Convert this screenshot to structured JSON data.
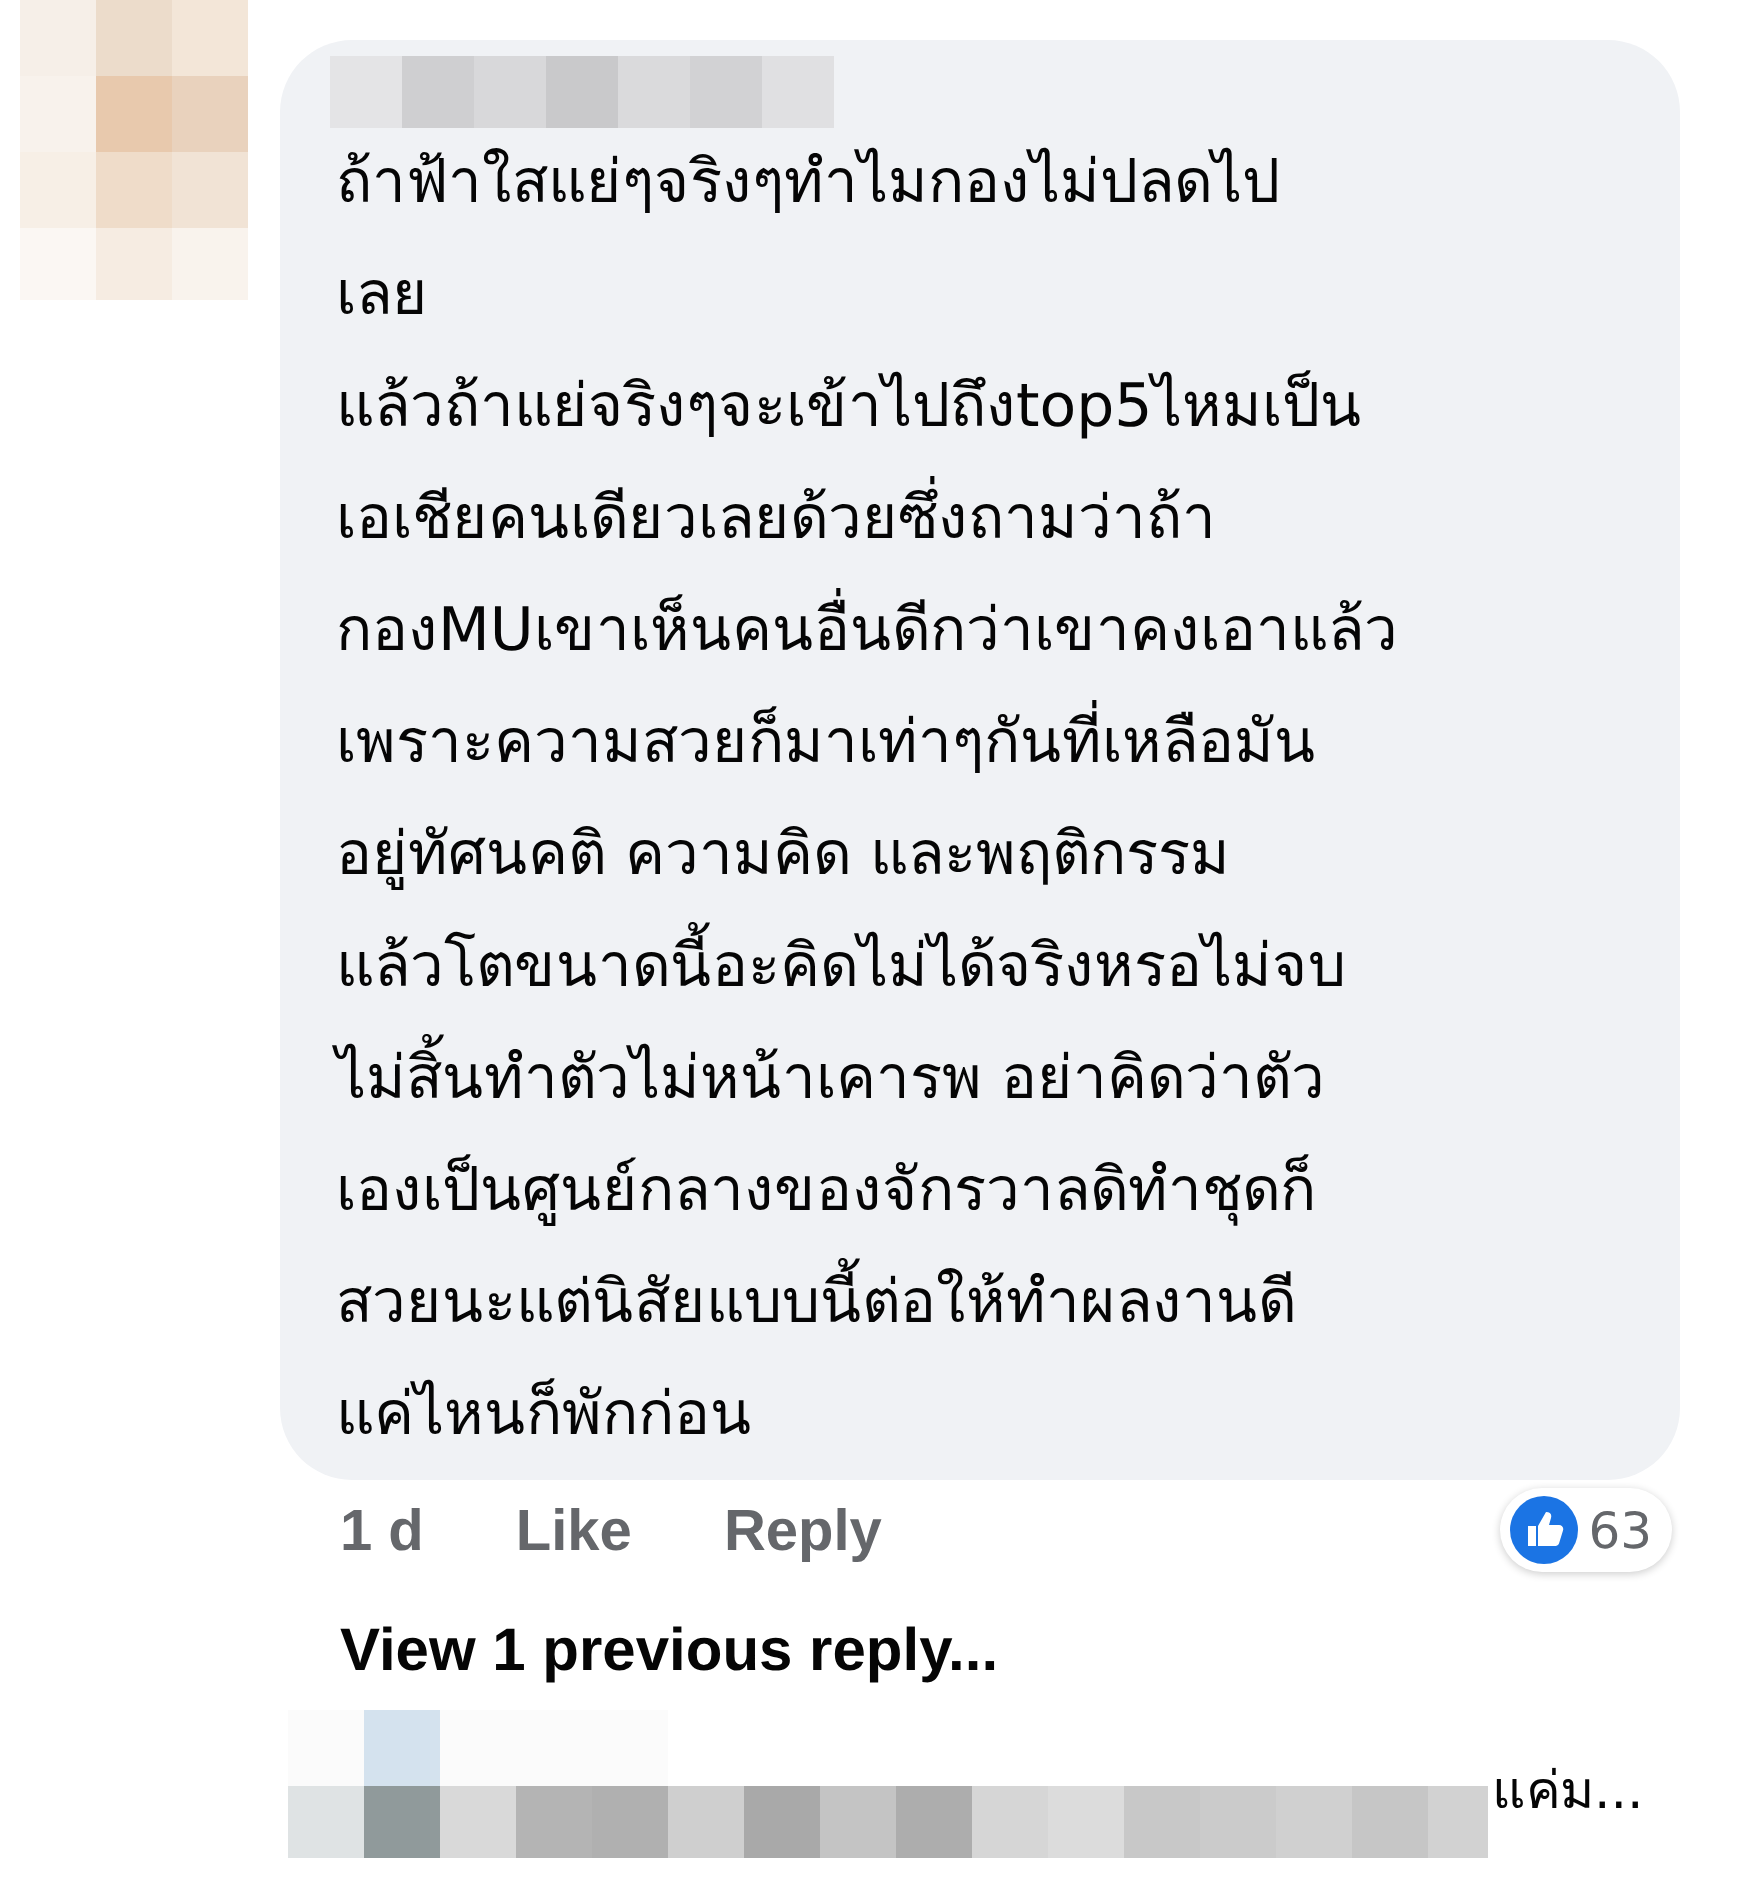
{
  "comment": {
    "lines": [
      "ถ้าฟ้าใสแย่ๆจริงๆทำไมกองไม่ปลดไป",
      "เลย",
      "แล้วถ้าแย่จริงๆจะเข้าไปถึงtop5ไหมเป็น",
      "เอเชียคนเดียวเลยด้วยซึ่งถามว่าถ้า",
      "กองMUเขาเห็นคนอื่นดีกว่าเขาคงเอาแล้ว",
      "เพราะความสวยก็มาเท่าๆกันที่เหลือมัน",
      "อยู่ทัศนคติ ความคิด และพฤติกรรม",
      "แล้วโตขนาดนี้อะคิดไม่ได้จริงหรอไม่จบ",
      "ไม่สิ้นทำตัวไม่หน้าเคารพ อย่าคิดว่าตัว",
      "เองเป็นศูนย์กลางของจักรวาลดิทำชุดก็",
      "สวยนะแต่นิสัยแบบนี้ต่อให้ทำผลงานดี",
      "แค่ไหนก็พักก่อน"
    ],
    "time": "1 d",
    "actions": [
      "Like",
      "Reply"
    ],
    "reaction_count": "63"
  },
  "view_previous": "View 1 previous reply...",
  "next_reply": {
    "preview": "แค่ม..."
  }
}
